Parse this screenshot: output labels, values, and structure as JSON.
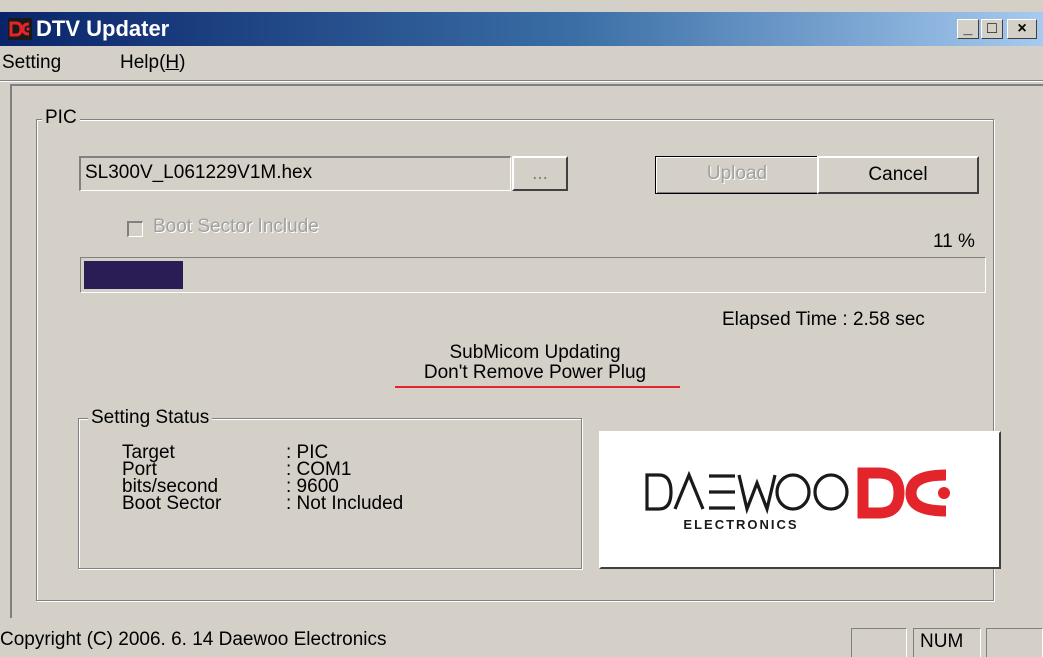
{
  "window": {
    "title": "DTV Updater",
    "controls": {
      "minimize": "_",
      "maximize": "□",
      "close": "×"
    }
  },
  "menu": {
    "items": [
      {
        "label": "Setting"
      },
      {
        "label": "Help(H)",
        "prefix": "Help(",
        "mnemonic": "H",
        "suffix": ")"
      }
    ]
  },
  "pic_group": {
    "label": "PIC",
    "file_path": "SL300V_L061229V1M.hex",
    "browse_label": "...",
    "upload_label": "Upload",
    "cancel_label": "Cancel",
    "boot_sector_label": "Boot Sector Include",
    "boot_sector_checked": false,
    "progress_percent_text": "11 %",
    "progress_value": 0.11,
    "elapsed_time": "Elapsed Time : 2.58 sec",
    "message_line1": "SubMicom Updating",
    "message_line2": "Don't Remove Power Plug"
  },
  "setting_status": {
    "label": "Setting Status",
    "rows": [
      {
        "key": "Target",
        "value": ": PIC"
      },
      {
        "key": "Port",
        "value": ": COM1"
      },
      {
        "key": "bits/second",
        "value": ": 9600"
      },
      {
        "key": "Boot Sector",
        "value": ": Not Included"
      }
    ]
  },
  "brand": {
    "name": "DAEWOO",
    "sub": "ELECTRONICS",
    "logo_color": "#e3242b"
  },
  "statusbar": {
    "copyright": "Copyright (C) 2006. 6. 14 Daewoo Electronics",
    "num": "NUM"
  },
  "colors": {
    "title_start": "#0a246a",
    "progress_fill": "#2a1d56",
    "underline": "#e3242b"
  }
}
